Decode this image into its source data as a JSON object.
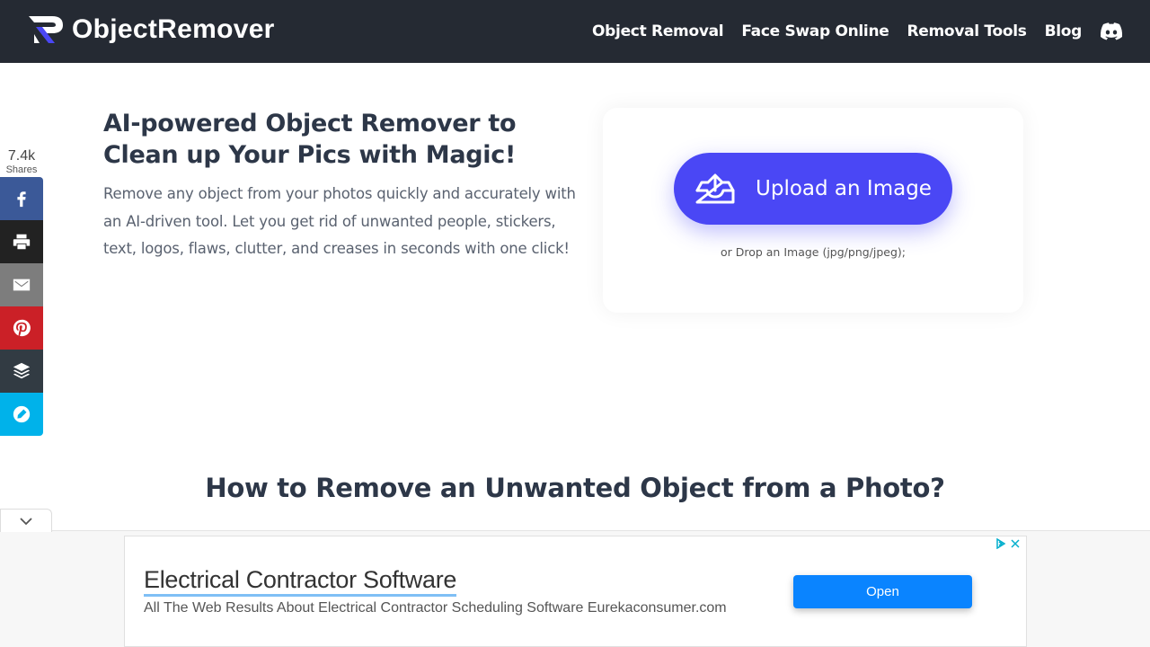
{
  "header": {
    "brand": "ObjectRemover",
    "nav": [
      {
        "label": "Object Removal"
      },
      {
        "label": "Face Swap Online"
      },
      {
        "label": "Removal Tools"
      },
      {
        "label": "Blog"
      }
    ],
    "discord_icon": "discord-icon"
  },
  "share": {
    "count": "7.4k",
    "label": "Shares",
    "buttons": [
      {
        "name": "facebook",
        "color": "#3b5998"
      },
      {
        "name": "print",
        "color": "#222222"
      },
      {
        "name": "email",
        "color": "#7d7d7d"
      },
      {
        "name": "pinterest",
        "color": "#cb2027"
      },
      {
        "name": "buffer",
        "color": "#323b43"
      },
      {
        "name": "copy-link",
        "color": "#00b2ea"
      }
    ]
  },
  "hero": {
    "title": "AI-powered Object Remover to Clean up Your Pics with Magic!",
    "description": "Remove any object from your photos quickly and accurately with an AI-driven tool. Let you get rid of unwanted people, stickers, text, logos, flaws, clutter, and creases in seconds with one click!"
  },
  "upload": {
    "button_label": "Upload an Image",
    "drop_hint": "or Drop an Image (jpg/png/jpeg);",
    "accent": "#4a47f5"
  },
  "section": {
    "title": "How to Remove an Unwanted Object from a Photo?"
  },
  "ad": {
    "title": "Electrical Contractor Software",
    "description": "All The Web Results About Electrical Contractor Scheduling Software Eurekaconsumer.com",
    "button_label": "Open"
  }
}
